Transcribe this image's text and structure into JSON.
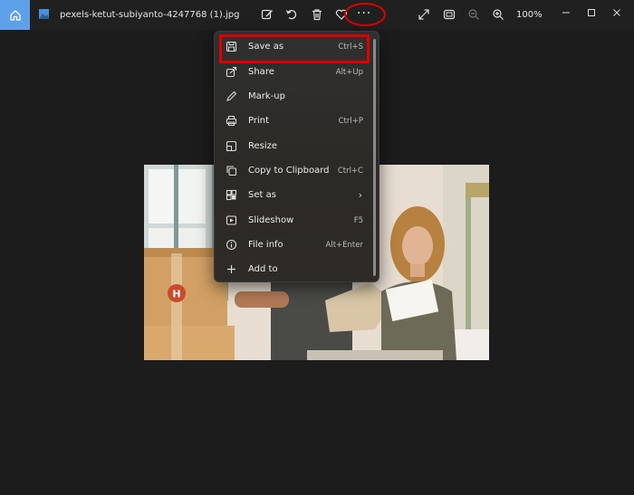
{
  "titlebar": {
    "file_name": "pexels-ketut-subiyanto-4247768 (1).jpg",
    "zoom_level": "100%",
    "more_button": "···"
  },
  "menu": {
    "items": [
      {
        "label": "Save as",
        "shortcut": "Ctrl+S",
        "icon": "save-icon"
      },
      {
        "label": "Share",
        "shortcut": "Alt+Up",
        "icon": "share-icon"
      },
      {
        "label": "Mark-up",
        "shortcut": "",
        "icon": "pen-icon"
      },
      {
        "label": "Print",
        "shortcut": "Ctrl+P",
        "icon": "printer-icon"
      },
      {
        "label": "Resize",
        "shortcut": "",
        "icon": "resize-icon"
      },
      {
        "label": "Copy to Clipboard",
        "shortcut": "Ctrl+C",
        "icon": "copy-icon"
      },
      {
        "label": "Set as",
        "shortcut": "",
        "icon": "set-as-icon",
        "submenu": "›"
      },
      {
        "label": "Slideshow",
        "shortcut": "F5",
        "icon": "slideshow-icon"
      },
      {
        "label": "File info",
        "shortcut": "Alt+Enter",
        "icon": "info-icon"
      },
      {
        "label": "Add to",
        "shortcut": "",
        "icon": "plus-icon"
      }
    ]
  },
  "colors": {
    "accent": "#5ea0ea",
    "annotation_red": "#e00000",
    "background": "#1c1c1c"
  },
  "photo": {
    "box_logo": "H"
  }
}
